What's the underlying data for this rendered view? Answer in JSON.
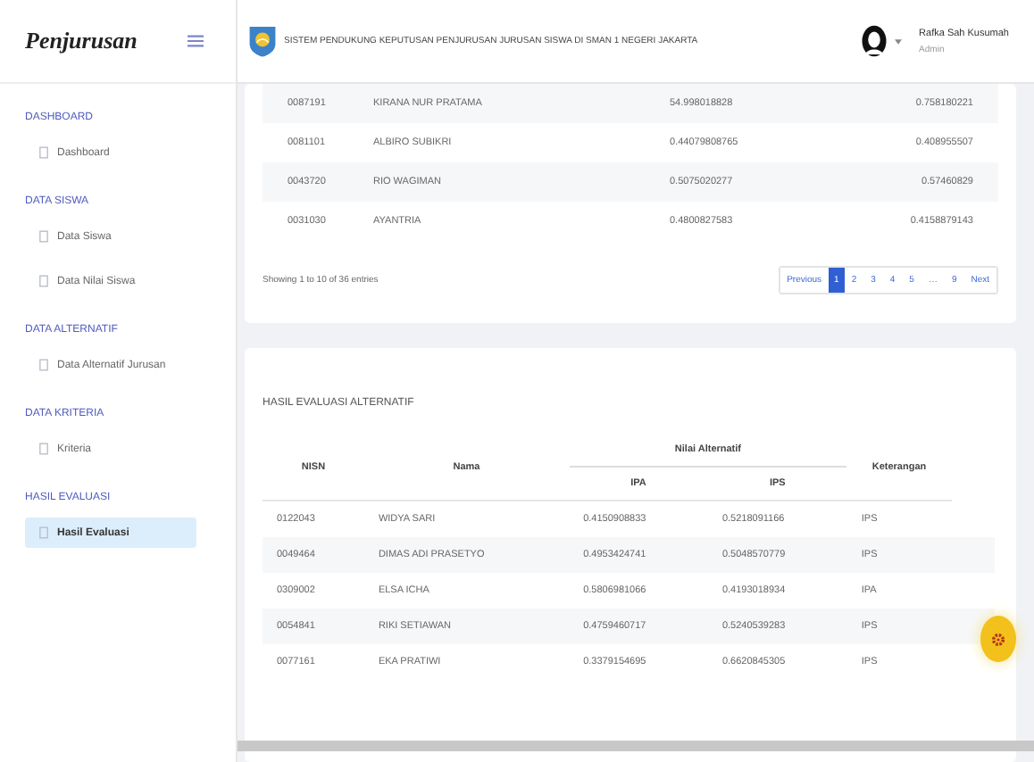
{
  "brand": "Penjurusan",
  "header": {
    "title": "SISTEM PENDUKUNG KEPUTUSAN PENJURUSAN JURUSAN SISWA DI SMAN 1 NEGERI JAKARTA",
    "user_name": "Rafka Sah Kusumah",
    "user_role": "Admin"
  },
  "sidebar": [
    {
      "heading": "DASHBOARD",
      "items": [
        {
          "label": "Dashboard",
          "selected": false
        }
      ]
    },
    {
      "heading": "DATA SISWA",
      "items": [
        {
          "label": "Data Siswa",
          "selected": false
        },
        {
          "label": "Data Nilai Siswa",
          "selected": false
        }
      ]
    },
    {
      "heading": "DATA ALTERNATIF",
      "items": [
        {
          "label": "Data Alternatif Jurusan",
          "selected": false
        }
      ]
    },
    {
      "heading": "DATA KRITERIA",
      "items": [
        {
          "label": "Kriteria",
          "selected": false
        }
      ]
    },
    {
      "heading": "HASIL EVALUASI",
      "items": [
        {
          "label": "Hasil Evaluasi",
          "selected": true
        }
      ]
    }
  ],
  "top_table": {
    "rows": [
      [
        "0087191",
        "KIRANA NUR PRATAMA",
        "54.998018828",
        "0.758180221"
      ],
      [
        "0081101",
        "ALBIRO SUBIKRI",
        "0.44079808765",
        "0.408955507"
      ],
      [
        "0043720",
        "RIO WAGIMAN",
        "0.5075020277",
        "0.57460829"
      ],
      [
        "0031030",
        "AYANTRIA",
        "0.4800827583",
        "0.4158879143"
      ]
    ],
    "summary": "Showing 1 to 10 of 36 entries",
    "pagination": [
      {
        "label": "Previous",
        "selected": false
      },
      {
        "label": "1",
        "selected": true
      },
      {
        "label": "2",
        "selected": false
      },
      {
        "label": "3",
        "selected": false
      },
      {
        "label": "4",
        "selected": false
      },
      {
        "label": "5",
        "selected": false
      },
      {
        "label": "…",
        "selected": false
      },
      {
        "label": "9",
        "selected": false
      },
      {
        "label": "Next",
        "selected": false
      }
    ]
  },
  "result_table": {
    "title": "HASIL EVALUASI ALTERNATIF",
    "columns": [
      "NISN",
      "Nama"
    ],
    "group_heading": "Nilai Alternatif",
    "sub_columns": [
      "IPA",
      "IPS"
    ],
    "last_column": "Keterangan",
    "rows": [
      [
        "0122043",
        "WIDYA SARI",
        "0.4150908833",
        "0.5218091166",
        "IPS"
      ],
      [
        "0049464",
        "DIMAS ADI PRASETYO",
        "0.4953424741",
        "0.5048570779",
        "IPS"
      ],
      [
        "0309002",
        "ELSA ICHA",
        "0.5806981066",
        "0.4193018934",
        "IPA"
      ],
      [
        "0054841",
        "RIKI SETIAWAN",
        "0.4759460717",
        "0.5240539283",
        "IPS"
      ],
      [
        "0077161",
        "EKA PRATIWI",
        "0.3379154695",
        "0.6620845305",
        "IPS"
      ]
    ]
  }
}
